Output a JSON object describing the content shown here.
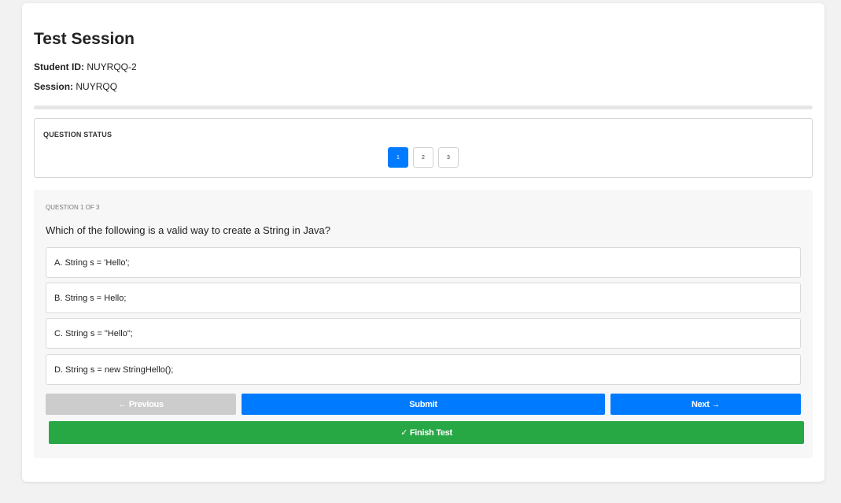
{
  "header": {
    "title": "Test Session",
    "student_label": "Student ID:",
    "student_id": "NUYRQQ-2",
    "session_label": "Session:",
    "session_id": "NUYRQQ"
  },
  "status": {
    "title": "QUESTION STATUS",
    "buttons": [
      "1",
      "2",
      "3"
    ],
    "active": "1"
  },
  "question": {
    "counter": "QUESTION 1 OF 3",
    "text": "Which of the following is a valid way to create a String in Java?",
    "options": [
      "A. String s = 'Hello';",
      "B. String s = Hello;",
      "C. String s = \"Hello\";",
      "D. String s = new StringHello();"
    ]
  },
  "actions": {
    "previous": "← Previous",
    "submit": "Submit",
    "next": "Next →",
    "finish": "✓ Finish Test"
  },
  "colors": {
    "primary": "#007bff",
    "success": "#28a745",
    "disabled": "#cccccc"
  }
}
